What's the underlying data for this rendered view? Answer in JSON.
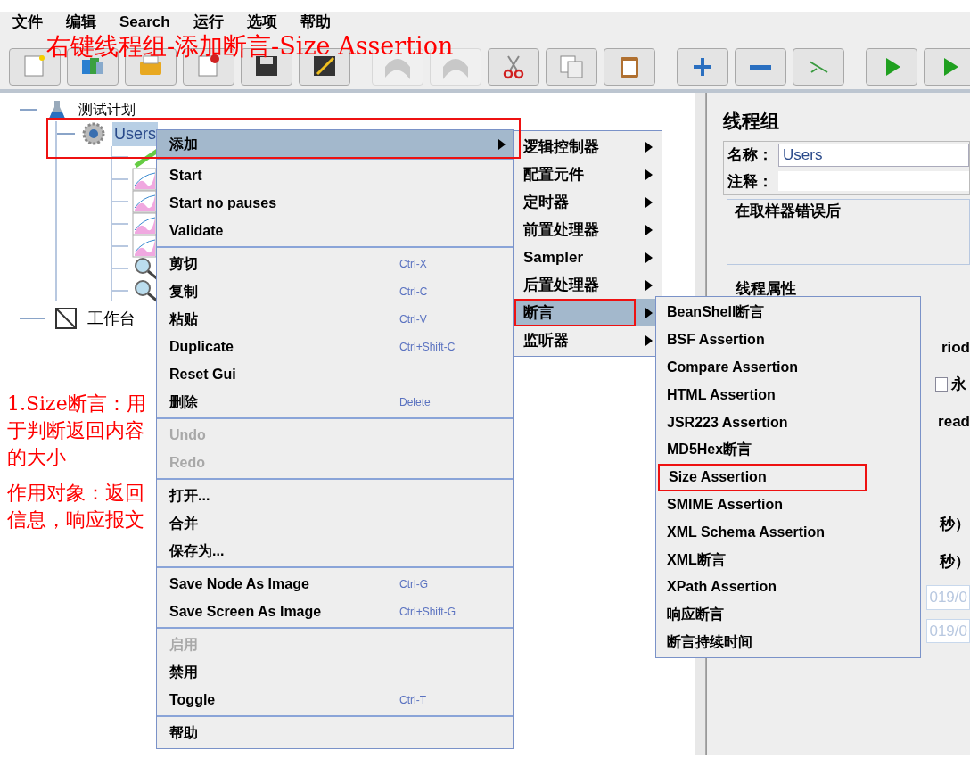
{
  "menubar": [
    {
      "label": "文件"
    },
    {
      "label": "编辑"
    },
    {
      "label": "Search"
    },
    {
      "label": "运行"
    },
    {
      "label": "选项"
    },
    {
      "label": "帮助"
    }
  ],
  "toolbar": [
    [
      {
        "kind": "new",
        "disabled": false
      },
      {
        "kind": "templates",
        "disabled": false
      },
      {
        "kind": "open",
        "disabled": false
      },
      {
        "kind": "close",
        "disabled": false
      },
      {
        "kind": "save",
        "disabled": false
      },
      {
        "kind": "saveas",
        "disabled": false
      }
    ],
    [
      {
        "kind": "undo",
        "disabled": true
      },
      {
        "kind": "redo",
        "disabled": true
      },
      {
        "kind": "cut",
        "disabled": false
      },
      {
        "kind": "copy",
        "disabled": false
      },
      {
        "kind": "paste",
        "disabled": false
      }
    ],
    [
      {
        "kind": "expand",
        "disabled": false
      },
      {
        "kind": "collapse",
        "disabled": false
      },
      {
        "kind": "toggle",
        "disabled": false
      }
    ],
    [
      {
        "kind": "start",
        "disabled": false
      },
      {
        "kind": "start2",
        "disabled": false
      }
    ]
  ],
  "tree": [
    {
      "kind": "plan",
      "label": "测试计划",
      "selected": false,
      "children": [
        {
          "kind": "group",
          "label": "Users",
          "selected": true,
          "children": [
            {
              "kind": "pencil"
            },
            {
              "kind": "graph"
            },
            {
              "kind": "graph"
            },
            {
              "kind": "graph"
            },
            {
              "kind": "graph"
            },
            {
              "kind": "magnifier"
            },
            {
              "kind": "magnifier"
            }
          ]
        }
      ]
    },
    {
      "kind": "workbench",
      "label": "工作台",
      "selected": false
    }
  ],
  "context_menu": [
    [
      {
        "label": "添加",
        "disabled": false,
        "selected": true,
        "submenu": true
      }
    ],
    [
      {
        "label": "Start",
        "disabled": false,
        "selected": false,
        "submenu": false
      },
      {
        "label": "Start no pauses",
        "disabled": false,
        "selected": false,
        "submenu": false
      },
      {
        "label": "Validate",
        "disabled": false,
        "selected": false,
        "submenu": false
      }
    ],
    [
      {
        "label": "剪切",
        "shortcut": "Ctrl-X",
        "disabled": false,
        "selected": false,
        "submenu": false
      },
      {
        "label": "复制",
        "shortcut": "Ctrl-C",
        "disabled": false,
        "selected": false,
        "submenu": false
      },
      {
        "label": "粘贴",
        "shortcut": "Ctrl-V",
        "disabled": false,
        "selected": false,
        "submenu": false
      },
      {
        "label": "Duplicate",
        "shortcut": "Ctrl+Shift-C",
        "disabled": false,
        "selected": false,
        "submenu": false
      },
      {
        "label": "Reset Gui",
        "disabled": false,
        "selected": false,
        "submenu": false
      },
      {
        "label": "删除",
        "shortcut": "Delete",
        "disabled": false,
        "selected": false,
        "submenu": false
      }
    ],
    [
      {
        "label": "Undo",
        "disabled": true,
        "selected": false,
        "submenu": false
      },
      {
        "label": "Redo",
        "disabled": true,
        "selected": false,
        "submenu": false
      }
    ],
    [
      {
        "label": "打开...",
        "disabled": false,
        "selected": false,
        "submenu": false
      },
      {
        "label": "合并",
        "disabled": false,
        "selected": false,
        "submenu": false
      },
      {
        "label": "保存为...",
        "disabled": false,
        "selected": false,
        "submenu": false
      }
    ],
    [
      {
        "label": "Save Node As Image",
        "shortcut": "Ctrl-G",
        "disabled": false,
        "selected": false,
        "submenu": false
      },
      {
        "label": "Save Screen As Image",
        "shortcut": "Ctrl+Shift-G",
        "disabled": false,
        "selected": false,
        "submenu": false
      }
    ],
    [
      {
        "label": "启用",
        "disabled": true,
        "selected": false,
        "submenu": false
      },
      {
        "label": "禁用",
        "disabled": false,
        "selected": false,
        "submenu": false
      },
      {
        "label": "Toggle",
        "shortcut": "Ctrl-T",
        "disabled": false,
        "selected": false,
        "submenu": false
      }
    ],
    [
      {
        "label": "帮助",
        "disabled": false,
        "selected": false,
        "submenu": false
      }
    ]
  ],
  "add_submenu": [
    {
      "label": "逻辑控制器",
      "selected": false,
      "highlighted": false
    },
    {
      "label": "配置元件",
      "selected": false,
      "highlighted": false
    },
    {
      "label": "定时器",
      "selected": false,
      "highlighted": false
    },
    {
      "label": "前置处理器",
      "selected": false,
      "highlighted": false
    },
    {
      "label": "Sampler",
      "selected": false,
      "highlighted": false
    },
    {
      "label": "后置处理器",
      "selected": false,
      "highlighted": false
    },
    {
      "label": "断言",
      "selected": true,
      "highlighted": true
    },
    {
      "label": "监听器",
      "selected": false,
      "highlighted": false
    }
  ],
  "assertion_submenu": [
    {
      "label": "BeanShell断言",
      "highlighted": false
    },
    {
      "label": "BSF Assertion",
      "highlighted": false
    },
    {
      "label": "Compare Assertion",
      "highlighted": false
    },
    {
      "label": "HTML Assertion",
      "highlighted": false
    },
    {
      "label": "JSR223 Assertion",
      "highlighted": false
    },
    {
      "label": "MD5Hex断言",
      "highlighted": false
    },
    {
      "label": "Size Assertion",
      "highlighted": true
    },
    {
      "label": "SMIME Assertion",
      "highlighted": false
    },
    {
      "label": "XML Schema Assertion",
      "highlighted": false
    },
    {
      "label": "XML断言",
      "highlighted": false
    },
    {
      "label": "XPath Assertion",
      "highlighted": false
    },
    {
      "label": "响应断言",
      "highlighted": false
    },
    {
      "label": "断言持续时间",
      "highlighted": false
    }
  ],
  "right_panel": {
    "title": "线程组",
    "name_label": "名称：",
    "name_value": "Users",
    "comment_label": "注释：",
    "error_group": "在取样器错误后",
    "thread_group": "线程属性",
    "fragments": [
      {
        "kind": "text",
        "text": "riod"
      },
      {
        "kind": "checkbox",
        "text": "永",
        "checked": false
      },
      {
        "kind": "text",
        "text": "read"
      },
      {
        "kind": "text",
        "text": "秒）"
      },
      {
        "kind": "text",
        "text": "秒）"
      },
      {
        "kind": "field",
        "text": "019/0"
      },
      {
        "kind": "field",
        "text": "019/0"
      }
    ]
  },
  "annotations": {
    "title": "右键线程组-添加断言-Size Assertion",
    "notes": [
      "1.Size断言：用于判断返回内容的大小",
      "作用对象：返回信息，响应报文"
    ]
  }
}
